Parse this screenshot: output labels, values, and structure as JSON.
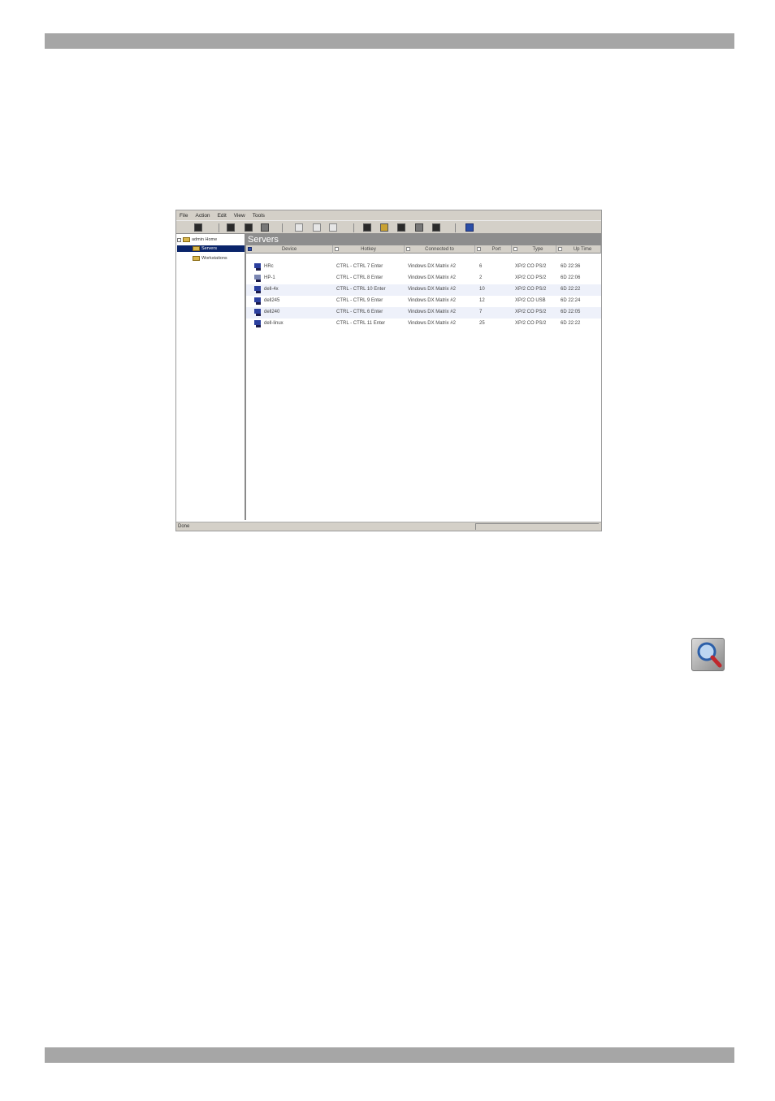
{
  "menu": [
    "File",
    "Action",
    "Edit",
    "View",
    "Tools"
  ],
  "tree": {
    "root": "admin Home",
    "items": [
      "Servers",
      "Workstations"
    ]
  },
  "content": {
    "title": "Servers",
    "columns": [
      "Device",
      "Hotkey",
      "Connected to",
      "Port",
      "Type",
      "Up Time"
    ],
    "rows": [
      {
        "device": "HRc",
        "hotkey": "CTRL - CTRL 7 Enter",
        "connected": "Vindows DX Matrix #2",
        "port": "6",
        "type": "XP/2 CO PS/2",
        "uptime": "6D 22:36"
      },
      {
        "device": "HP-1",
        "hotkey": "CTRL - CTRL 8 Enter",
        "connected": "Vindows DX Matrix #2",
        "port": "2",
        "type": "XP/2 CO PS/2",
        "uptime": "6D 22:06"
      },
      {
        "device": "dell-4x",
        "hotkey": "CTRL - CTRL 10 Enter",
        "connected": "Vindows DX Matrix #2",
        "port": "10",
        "type": "XP/2 CO PS/2",
        "uptime": "6D 22:22"
      },
      {
        "device": "dell245",
        "hotkey": "CTRL - CTRL 9 Enter",
        "connected": "Vindows DX Matrix #2",
        "port": "12",
        "type": "XP/2 CO USB",
        "uptime": "6D 22:24"
      },
      {
        "device": "dell240",
        "hotkey": "CTRL - CTRL 6 Enter",
        "connected": "Vindows DX Matrix #2",
        "port": "7",
        "type": "XP/2 CO PS/2",
        "uptime": "6D 22:05"
      },
      {
        "device": "dell-linux",
        "hotkey": "CTRL - CTRL 11 Enter",
        "connected": "Vindows DX Matrix #2",
        "port": "25",
        "type": "XP/2 CO PS/2",
        "uptime": "6D 22:22"
      }
    ]
  },
  "status": "Done"
}
